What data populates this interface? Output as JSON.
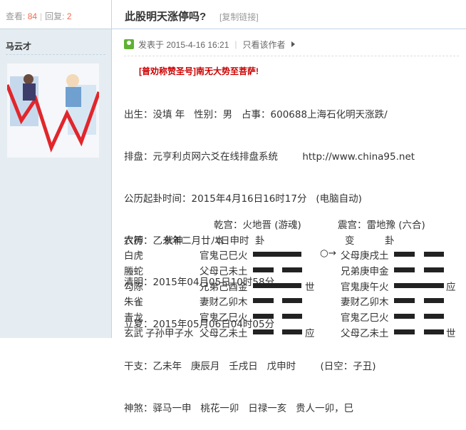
{
  "stats": {
    "views_label": "查看:",
    "views": "84",
    "replies_label": "回复:",
    "replies": "2"
  },
  "title": "此股明天涨停吗?",
  "copy_link": "[复制链接]",
  "author": "马云才",
  "post": {
    "published": "发表于 2015-4-16 16:21",
    "only_author": "只看该作者"
  },
  "promo": {
    "prefix": "[普劝称赞圣号]",
    "text": "南无大势至菩萨!"
  },
  "lines": [
    "出生：没填 年   性别：男   占事：600688上海石化明天涨跌/",
    "排盘：元亨利贞网六爻在线排盘系统        http://www.china95.net",
    "公历起卦时间：2015年4月16日16时17分   (电脑自动)",
    "农历：乙未年二月廿八日申时",
    "清明：2015年04月05日10时58分",
    "立夏：2015年05月06日04时05分",
    "干支：乙未年   庚辰月   壬戌日   戊申时        (日空：子丑)",
    "神煞：驿马一申   桃花一卯   日禄一亥   贵人一卯，巳"
  ],
  "gua": {
    "main_title": "乾宫：火地晋 (游魂)",
    "change_title": "震宫：雷地豫 (六合)",
    "col_head": {
      "liushen": "六神",
      "fushen": "伏神",
      "ben": "本",
      "gua1": "卦",
      "bian": "变",
      "gua2": "卦"
    },
    "rows": [
      {
        "shen": "白虎",
        "fu": "",
        "ben": "官鬼己巳火",
        "mark": "",
        "move": "○→",
        "bian": "父母庚戌土",
        "mark2": ""
      },
      {
        "shen": "螣蛇",
        "fu": "",
        "ben": "父母己未土",
        "mark": "",
        "move": "",
        "bian": "兄弟庚申金",
        "mark2": ""
      },
      {
        "shen": "勾陈",
        "fu": "",
        "ben": "兄弟己酉金",
        "mark": "世",
        "move": "",
        "bian": "官鬼庚午火",
        "mark2": "应"
      },
      {
        "shen": "朱雀",
        "fu": "",
        "ben": "妻财乙卯木",
        "mark": "",
        "move": "",
        "bian": "妻财乙卯木",
        "mark2": ""
      },
      {
        "shen": "青龙",
        "fu": "",
        "ben": "官鬼乙巳火",
        "mark": "",
        "move": "",
        "bian": "官鬼乙巳火",
        "mark2": ""
      },
      {
        "shen": "玄武",
        "fu": "子孙甲子水",
        "ben": "父母乙未土",
        "mark": "应",
        "move": "",
        "bian": "父母乙未土",
        "mark2": "世"
      }
    ]
  }
}
